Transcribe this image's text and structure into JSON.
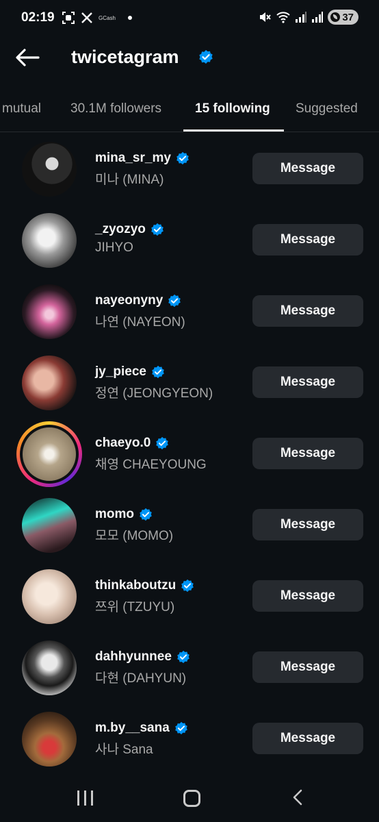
{
  "status_bar": {
    "time": "02:19",
    "gcash_label": "GCash",
    "battery": "37",
    "icons": [
      "screenshot-icon",
      "x-logo-icon",
      "gcash-icon",
      "notification-dot",
      "mute-icon",
      "wifi-icon",
      "signal-icon",
      "signal-icon",
      "battery-icon"
    ]
  },
  "header": {
    "title": "twicetagram",
    "verified_icon": "verified-badge-icon",
    "back_icon": "arrow-left-icon"
  },
  "tabs": [
    {
      "label": "mutual",
      "active": false
    },
    {
      "label": "30.1M followers",
      "active": false
    },
    {
      "label": "15 following",
      "active": true
    },
    {
      "label": "Suggested",
      "active": false
    }
  ],
  "accounts": [
    {
      "username": "mina_sr_my",
      "name": "미나 (MINA)",
      "button": "Message",
      "verified": true,
      "story": false
    },
    {
      "username": "_zyozyo",
      "name": "JIHYO",
      "button": "Message",
      "verified": true,
      "story": false
    },
    {
      "username": "nayeonyny",
      "name": "나연 (NAYEON)",
      "button": "Message",
      "verified": true,
      "story": false
    },
    {
      "username": "jy_piece",
      "name": "정연 (JEONGYEON)",
      "button": "Message",
      "verified": true,
      "story": false
    },
    {
      "username": "chaeyo.0",
      "name": "채영 CHAEYOUNG",
      "button": "Message",
      "verified": true,
      "story": true
    },
    {
      "username": "momo",
      "name": "모모 (MOMO)",
      "button": "Message",
      "verified": true,
      "story": false
    },
    {
      "username": "thinkaboutzu",
      "name": "쯔위 (TZUYU)",
      "button": "Message",
      "verified": true,
      "story": false
    },
    {
      "username": "dahhyunnee",
      "name": "다현 (DAHYUN)",
      "button": "Message",
      "verified": true,
      "story": false
    },
    {
      "username": "m.by__sana",
      "name": "사나 Sana",
      "button": "Message",
      "verified": true,
      "story": false
    }
  ],
  "nav_bar": {
    "icons": [
      "recent-apps-icon",
      "home-icon",
      "back-icon"
    ]
  },
  "colors": {
    "background": "#0c1014",
    "verified_blue": "#0095f6",
    "button_bg": "#262a2f",
    "secondary_text": "#a8a8a8"
  }
}
